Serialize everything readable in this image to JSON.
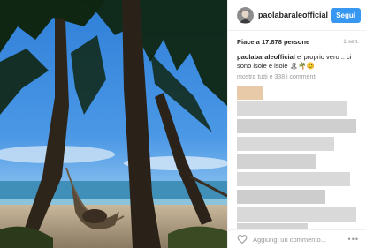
{
  "post": {
    "username": "paolabaraleofficial",
    "follow_label": "Segui",
    "likes_text": "Piace a 17.878 persone",
    "timestamp": "1 sett.",
    "caption_user": "paolabaraleofficial",
    "caption_text": " e' proprio vero .. ci sono isole e isole 🏝🌴😊",
    "more_comments": "mostra tutti e 338 i commenti",
    "comment_placeholder": "Aggiungi un commento...",
    "more_options": "•••",
    "photo_description_icon": "beach-hammock-photo"
  },
  "icons": {
    "like": "heart-icon",
    "options": "ellipsis-icon"
  },
  "colors": {
    "follow_button": "#3897f0",
    "text": "#262626",
    "muted": "#999999"
  }
}
